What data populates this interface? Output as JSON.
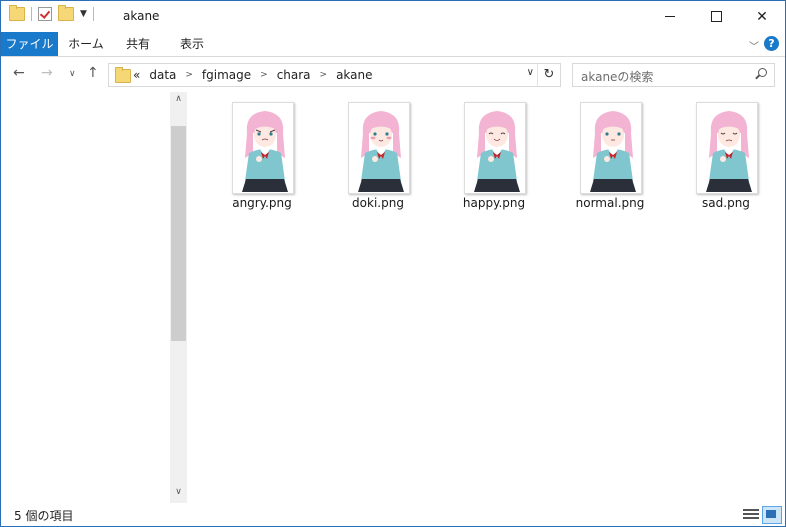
{
  "window": {
    "title": "akane"
  },
  "ribbon": {
    "tabs": [
      {
        "label": "ファイル"
      },
      {
        "label": "ホーム"
      },
      {
        "label": "共有"
      },
      {
        "label": "表示"
      }
    ]
  },
  "address": {
    "overflow_marker": "«",
    "breadcrumbs": [
      "data",
      "fgimage",
      "chara",
      "akane"
    ]
  },
  "search": {
    "placeholder": "akaneの検索"
  },
  "files": [
    {
      "name": "angry.png",
      "expression": "angry"
    },
    {
      "name": "doki.png",
      "expression": "doki"
    },
    {
      "name": "happy.png",
      "expression": "happy"
    },
    {
      "name": "normal.png",
      "expression": "normal"
    },
    {
      "name": "sad.png",
      "expression": "sad"
    }
  ],
  "status": {
    "item_count": "5 個の項目"
  },
  "colors": {
    "accent": "#1979ca",
    "hair": "#f3b3d3",
    "jacket": "#7fc6cf",
    "skirt": "#2b2f3a",
    "ribbon": "#c0282d"
  }
}
